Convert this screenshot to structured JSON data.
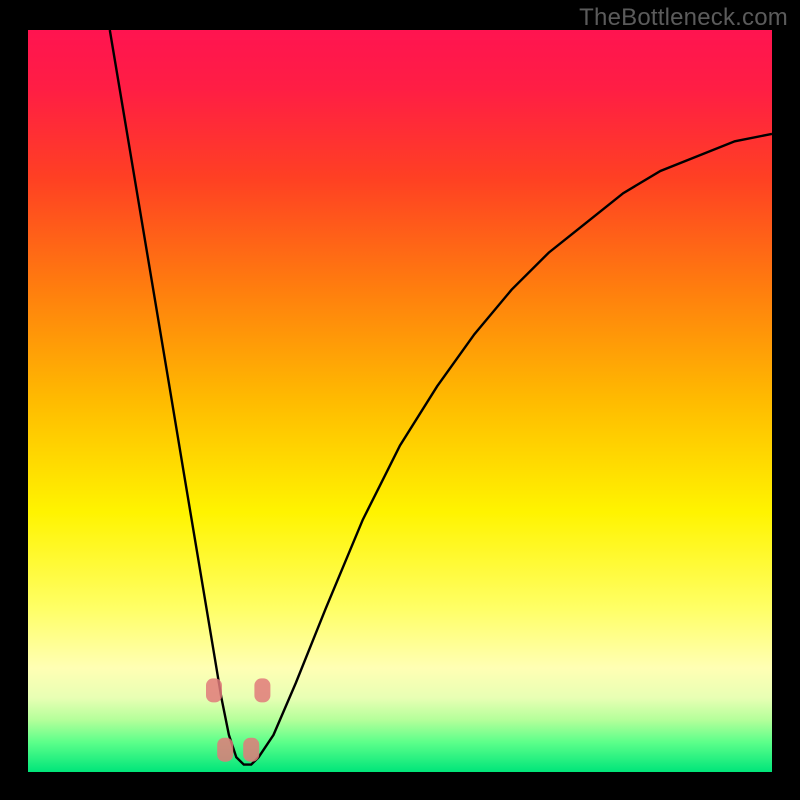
{
  "watermark": {
    "text": "TheBottleneck.com"
  },
  "chart_data": {
    "type": "line",
    "title": "",
    "xlabel": "",
    "ylabel": "",
    "xlim": [
      0,
      100
    ],
    "ylim": [
      0,
      100
    ],
    "grid": false,
    "legend": null,
    "gradient_stops": [
      {
        "offset": 0,
        "color": "#ff1450"
      },
      {
        "offset": 0.08,
        "color": "#ff1e44"
      },
      {
        "offset": 0.2,
        "color": "#ff4023"
      },
      {
        "offset": 0.35,
        "color": "#ff7e0e"
      },
      {
        "offset": 0.5,
        "color": "#ffbb00"
      },
      {
        "offset": 0.65,
        "color": "#fff400"
      },
      {
        "offset": 0.78,
        "color": "#ffff66"
      },
      {
        "offset": 0.86,
        "color": "#ffffb4"
      },
      {
        "offset": 0.9,
        "color": "#e8ffb4"
      },
      {
        "offset": 0.93,
        "color": "#b4ff9a"
      },
      {
        "offset": 0.96,
        "color": "#5cff8a"
      },
      {
        "offset": 1.0,
        "color": "#00e57a"
      }
    ],
    "series": [
      {
        "name": "bottleneck-curve",
        "x": [
          11,
          13,
          15,
          17,
          19,
          21,
          23,
          25,
          26,
          27,
          28,
          29,
          30,
          31,
          33,
          36,
          40,
          45,
          50,
          55,
          60,
          65,
          70,
          75,
          80,
          85,
          90,
          95,
          100
        ],
        "y": [
          100,
          88,
          76,
          64,
          52,
          40,
          28,
          16,
          10,
          5,
          2,
          1,
          1,
          2,
          5,
          12,
          22,
          34,
          44,
          52,
          59,
          65,
          70,
          74,
          78,
          81,
          83,
          85,
          86
        ]
      }
    ],
    "markers": [
      {
        "x": 25.0,
        "y": 11.0
      },
      {
        "x": 31.5,
        "y": 11.0
      },
      {
        "x": 26.5,
        "y": 3.0
      },
      {
        "x": 30.0,
        "y": 3.0
      }
    ]
  }
}
